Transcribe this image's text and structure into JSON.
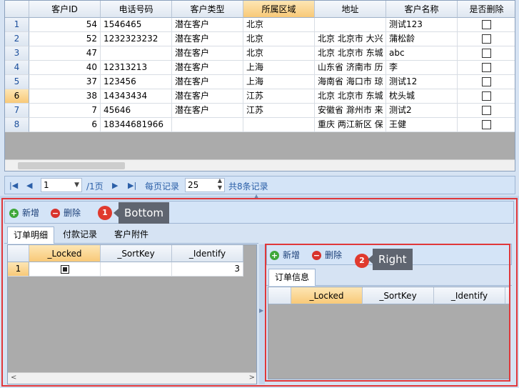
{
  "top_grid": {
    "columns": [
      "客户ID",
      "电话号码",
      "客户类型",
      "所属区域",
      "地址",
      "客户名称",
      "是否删除"
    ],
    "rows": [
      {
        "n": "1",
        "id": "54",
        "phone": "1546465",
        "type": "潜在客户",
        "region": "北京",
        "addr": "",
        "name": "测试123"
      },
      {
        "n": "2",
        "id": "52",
        "phone": "1232323232",
        "type": "潜在客户",
        "region": "北京",
        "addr": "北京 北京市 大兴",
        "name": "蒲松龄"
      },
      {
        "n": "3",
        "id": "47",
        "phone": "",
        "type": "潜在客户",
        "region": "北京",
        "addr": "北京 北京市 东城",
        "name": "abc"
      },
      {
        "n": "4",
        "id": "40",
        "phone": "12313213",
        "type": "潜在客户",
        "region": "上海",
        "addr": "山东省 济南市 历",
        "name": "李"
      },
      {
        "n": "5",
        "id": "37",
        "phone": "123456",
        "type": "潜在客户",
        "region": "上海",
        "addr": "海南省 海口市 琼",
        "name": "测试12"
      },
      {
        "n": "6",
        "id": "38",
        "phone": "14343434",
        "type": "潜在客户",
        "region": "江苏",
        "addr": "北京 北京市 东城",
        "name": "枕头城"
      },
      {
        "n": "7",
        "id": "7",
        "phone": "45646",
        "type": "潜在客户",
        "region": "江苏",
        "addr": "安徽省 滁州市 来",
        "name": "测试2"
      },
      {
        "n": "8",
        "id": "6",
        "phone": "18344681966",
        "type": "",
        "region": "",
        "addr": "重庆 两江新区 保",
        "name": "王健"
      }
    ]
  },
  "pager": {
    "page": "1",
    "total_pages": "/1页",
    "page_size_label": "每页记录",
    "page_size": "25",
    "total_records": "共8条记录"
  },
  "bottom": {
    "add_label": "新增",
    "delete_label": "删除",
    "badge": "1",
    "callout": "Bottom",
    "tabs": [
      "订单明细",
      "付款记录",
      "客户附件"
    ],
    "grid": {
      "columns": [
        "_Locked",
        "_SortKey",
        "_Identify"
      ],
      "row": {
        "n": "1",
        "identify": "3"
      }
    }
  },
  "right": {
    "add_label": "新增",
    "delete_label": "删除",
    "badge": "2",
    "callout": "Right",
    "tab": "订单信息",
    "grid": {
      "columns": [
        "_Locked",
        "_SortKey",
        "_Identify"
      ]
    }
  }
}
